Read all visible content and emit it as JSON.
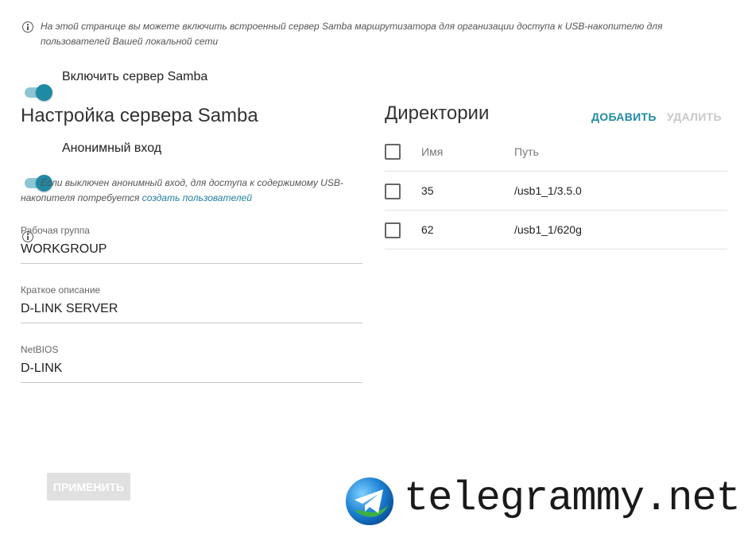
{
  "intro": {
    "text": "На этой странице вы можете включить встроенный сервер Samba маршрутизатора для организации доступа к USB-накопителю для пользователей Вашей локальной сети"
  },
  "samba_toggle": {
    "label": "Включить сервер Samba",
    "enabled": true
  },
  "settings": {
    "title": "Настройка сервера Samba",
    "anon_toggle": {
      "label": "Анонимный вход",
      "enabled": true
    },
    "anon_note": "Если выключен анонимный вход, для доступа к содержимому USB-накопителя потребуется ",
    "anon_note_link": "создать пользователей",
    "workgroup": {
      "label": "Рабочая группа",
      "value": "WORKGROUP"
    },
    "description": {
      "label": "Краткое описание",
      "value": "D-LINK SERVER"
    },
    "netbios": {
      "label": "NetBIOS",
      "value": "D-LINK"
    }
  },
  "directories": {
    "title": "Директории",
    "add_label": "ДОБАВИТЬ",
    "delete_label": "УДАЛИТЬ",
    "columns": [
      "Имя",
      "Путь"
    ],
    "rows": [
      {
        "name": "35",
        "path": "/usb1_1/3.5.0"
      },
      {
        "name": "62",
        "path": "/usb1_1/620g"
      }
    ]
  },
  "apply_label": "ПРИМЕНИТЬ",
  "watermark": "telegrammy.net",
  "colors": {
    "accent": "#1f8aa6",
    "link": "#1f7fa0",
    "disabled": "#c8c8c8"
  }
}
